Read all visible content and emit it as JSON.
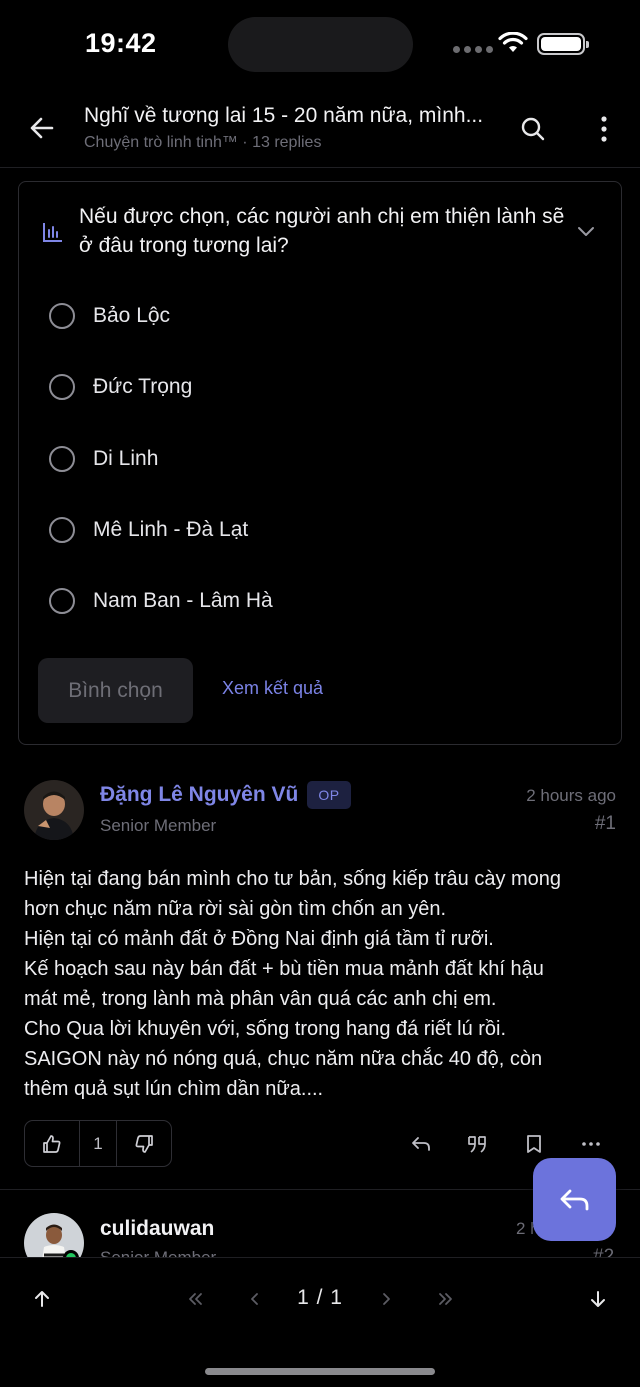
{
  "status_bar": {
    "time": "19:42"
  },
  "header": {
    "title": "Nghĩ về tương lai 15 - 20 năm nữa, mình...",
    "subtitle": "Chuyện trò linh tinh™ · 13 replies",
    "back_icon": "arrow-left-icon",
    "search_icon": "search-icon",
    "more_icon": "more-vertical-icon"
  },
  "poll": {
    "question": "Nếu được chọn, các người anh chị em thiện lành sẽ ở đâu trong tương lai?",
    "options": [
      "Bảo Lộc",
      "Đức Trọng",
      "Di Linh",
      "Mê Linh - Đà Lạt",
      "Nam Ban - Lâm Hà"
    ],
    "vote_label": "Bình chọn",
    "results_label": "Xem kết quả"
  },
  "posts": [
    {
      "author": "Đặng Lê Nguyên Vũ",
      "badge": "OP",
      "rank": "Senior Member",
      "time": "2 hours ago",
      "number": "#1",
      "body_lines": [
        "Hiện tại đang bán mình cho tư bản, sống kiếp trâu cày mong",
        "hơn chục năm nữa rời sài gòn tìm chốn an yên.",
        "Hiện tại có mảnh đất ở Đồng Nai định giá tầm tỉ rưỡi.",
        "Kế hoạch sau này bán đất + bù tiền mua mảnh đất khí hậu",
        "mát mẻ, trong lành mà phân vân quá các anh chị em.",
        "Cho Qua lời khuyên với, sống trong hang đá riết lú rồi.",
        "SAIGON này nó nóng quá, chục năm nữa chắc 40 độ, còn",
        "thêm quả sụt lún chìm dần nữa...."
      ],
      "like_count": "1"
    },
    {
      "author": "culidauwan",
      "rank": "Senior Member",
      "time": "2 h",
      "number": "#2"
    }
  ],
  "pagination": {
    "indicator": "1 / 1"
  },
  "colors": {
    "accent": "#7f86e6",
    "fab": "#6c73dc",
    "background": "#000000",
    "online": "#22c55e"
  }
}
